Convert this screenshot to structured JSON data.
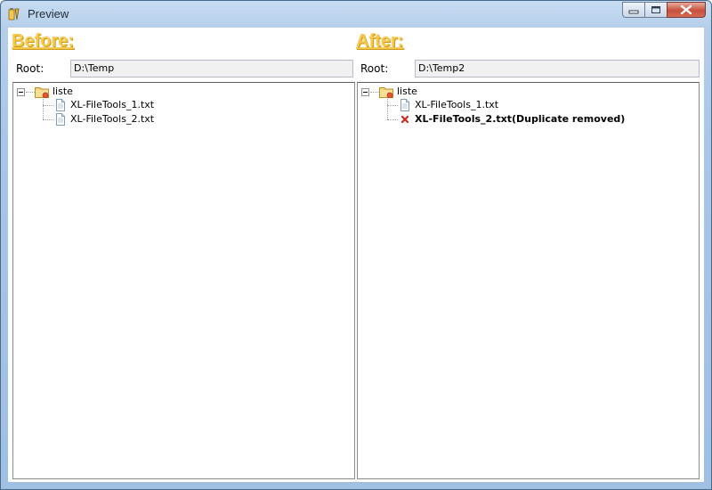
{
  "window": {
    "title": "Preview"
  },
  "before": {
    "heading": "Before:",
    "root_label": "Root:",
    "root_value": "D:\\Temp",
    "tree": {
      "root": "liste",
      "children": [
        "XL-FileTools_1.txt",
        "XL-FileTools_2.txt"
      ]
    }
  },
  "after": {
    "heading": "After:",
    "root_label": "Root:",
    "root_value": "D:\\Temp2",
    "tree": {
      "root": "liste",
      "children": [
        "XL-FileTools_1.txt",
        "XL-FileTools_2.txt(Duplicate removed)"
      ]
    }
  },
  "icons": {
    "app": "pencil-app-icon",
    "folder": "folder-icon",
    "file": "text-file-icon",
    "removed": "red-x-icon"
  },
  "colors": {
    "heading": "#f7c84a",
    "removed": "#cc2b1d"
  }
}
